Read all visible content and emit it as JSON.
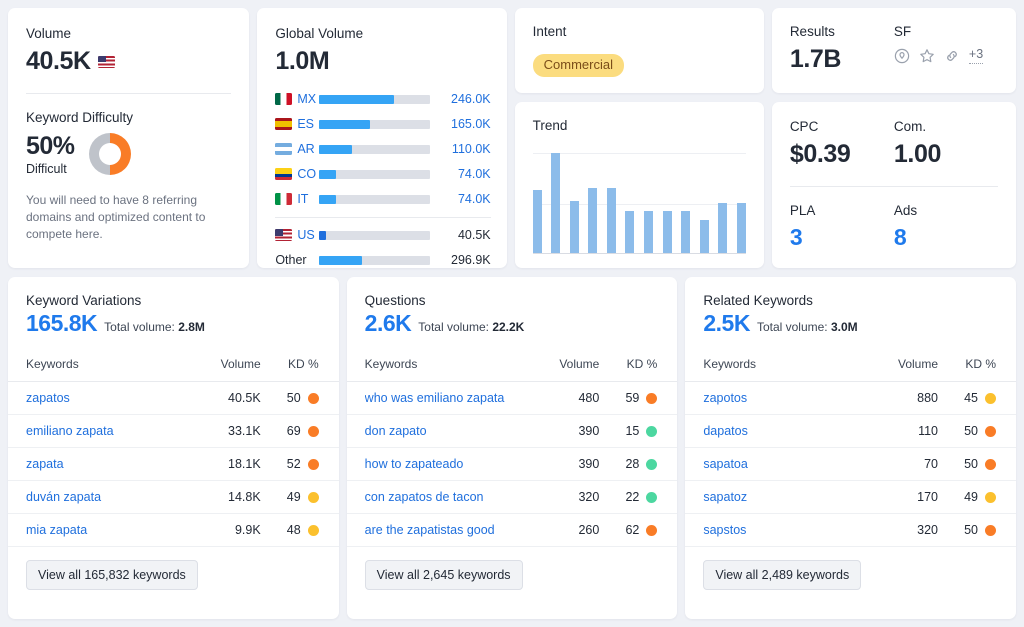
{
  "volume_card": {
    "volume_label": "Volume",
    "volume_value": "40.5K",
    "volume_flag": "us-flag-icon",
    "kd_label": "Keyword Difficulty",
    "kd_value": "50%",
    "kd_word": "Difficult",
    "kd_percent": 50,
    "kd_note": "You will need to have 8 referring domains and optimized content to compete here.",
    "kd_color": "#F97C26",
    "kd_track_color": "#BFC3CA"
  },
  "global_volume_card": {
    "title": "Global Volume",
    "value": "1.0M",
    "countries": [
      {
        "code": "MX",
        "flag": "flag-mx",
        "value": "246.0K",
        "pct": 68
      },
      {
        "code": "ES",
        "flag": "flag-es",
        "value": "165.0K",
        "pct": 46
      },
      {
        "code": "AR",
        "flag": "flag-ar",
        "value": "110.0K",
        "pct": 30
      },
      {
        "code": "CO",
        "flag": "flag-co",
        "value": "74.0K",
        "pct": 15
      },
      {
        "code": "IT",
        "flag": "flag-it",
        "value": "74.0K",
        "pct": 15
      }
    ],
    "current": {
      "code": "US",
      "flag": "flag-us",
      "value": "40.5K",
      "pct": 6
    },
    "other": {
      "code": "Other",
      "flag": "",
      "value": "296.9K",
      "pct": 39
    }
  },
  "intent_card": {
    "title": "Intent",
    "badge": "Commercial",
    "badge_bg": "#FBDC7F",
    "badge_fg": "#7A4D19"
  },
  "results_card": {
    "results_label": "Results",
    "results_value": "1.7B",
    "sf_label": "SF",
    "sf_icons": [
      "map-pin-icon",
      "star-icon",
      "link-icon"
    ],
    "sf_more": "+3"
  },
  "cpc_card": {
    "cpc_label": "CPC",
    "cpc_value": "$0.39",
    "com_label": "Com.",
    "com_value": "1.00",
    "pla_label": "PLA",
    "pla_value": "3",
    "ads_label": "Ads",
    "ads_value": "8"
  },
  "chart_data": {
    "type": "bar",
    "title": "Trend",
    "categories": [
      "1",
      "2",
      "3",
      "4",
      "5",
      "6",
      "7",
      "8",
      "9",
      "10",
      "11",
      "12"
    ],
    "values": [
      63,
      100,
      52,
      65,
      65,
      42,
      42,
      42,
      42,
      33,
      50,
      50
    ],
    "xlabel": "",
    "ylabel": "",
    "ylim": [
      0,
      100
    ],
    "grid": true,
    "legend": false,
    "bar_color": "#8CBCEA"
  },
  "tables": [
    {
      "title": "Keyword Variations",
      "count": "165.8K",
      "total_label": "Total volume:",
      "total_value": "2.8M",
      "columns": {
        "keyword": "Keywords",
        "volume": "Volume",
        "kd": "KD %"
      },
      "rows": [
        {
          "keyword": "zapatos",
          "volume": "40.5K",
          "kd": "50",
          "dot": "#F97C26"
        },
        {
          "keyword": "emiliano zapata",
          "volume": "33.1K",
          "kd": "69",
          "dot": "#F97C26"
        },
        {
          "keyword": "zapata",
          "volume": "18.1K",
          "kd": "52",
          "dot": "#F97C26"
        },
        {
          "keyword": "duván zapata",
          "volume": "14.8K",
          "kd": "49",
          "dot": "#FBC02D"
        },
        {
          "keyword": "mia zapata",
          "volume": "9.9K",
          "kd": "48",
          "dot": "#FBC02D"
        }
      ],
      "button": "View all 165,832 keywords"
    },
    {
      "title": "Questions",
      "count": "2.6K",
      "total_label": "Total volume:",
      "total_value": "22.2K",
      "columns": {
        "keyword": "Keywords",
        "volume": "Volume",
        "kd": "KD %"
      },
      "rows": [
        {
          "keyword": "who was emiliano zapata",
          "volume": "480",
          "kd": "59",
          "dot": "#F97C26"
        },
        {
          "keyword": "don zapato",
          "volume": "390",
          "kd": "15",
          "dot": "#4CD7A0"
        },
        {
          "keyword": "how to zapateado",
          "volume": "390",
          "kd": "28",
          "dot": "#4CD7A0"
        },
        {
          "keyword": "con zapatos de tacon",
          "volume": "320",
          "kd": "22",
          "dot": "#4CD7A0"
        },
        {
          "keyword": "are the zapatistas good",
          "volume": "260",
          "kd": "62",
          "dot": "#F97C26"
        }
      ],
      "button": "View all 2,645 keywords"
    },
    {
      "title": "Related Keywords",
      "count": "2.5K",
      "total_label": "Total volume:",
      "total_value": "3.0M",
      "columns": {
        "keyword": "Keywords",
        "volume": "Volume",
        "kd": "KD %"
      },
      "rows": [
        {
          "keyword": "zapotos",
          "volume": "880",
          "kd": "45",
          "dot": "#FBC02D"
        },
        {
          "keyword": "dapatos",
          "volume": "110",
          "kd": "50",
          "dot": "#F97C26"
        },
        {
          "keyword": "sapatoa",
          "volume": "70",
          "kd": "50",
          "dot": "#F97C26"
        },
        {
          "keyword": "sapatoz",
          "volume": "170",
          "kd": "49",
          "dot": "#FBC02D"
        },
        {
          "keyword": "sapstos",
          "volume": "320",
          "kd": "50",
          "dot": "#F97C26"
        }
      ],
      "button": "View all 2,489 keywords"
    }
  ]
}
